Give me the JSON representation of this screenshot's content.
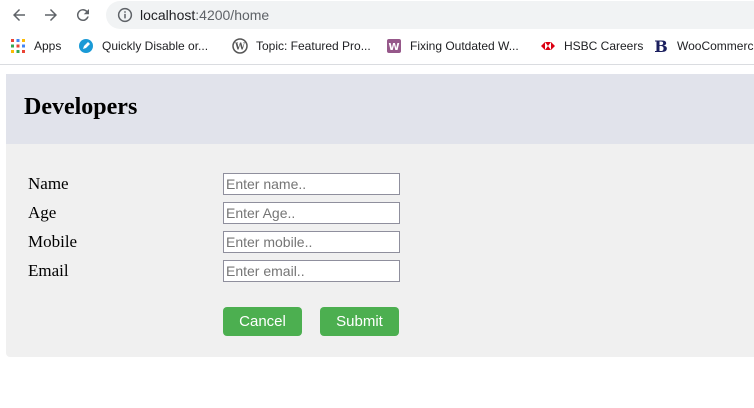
{
  "browser": {
    "url_host": "localhost",
    "url_path": ":4200/home",
    "bookmarks": [
      {
        "label": "Apps",
        "icon": "apps-grid-icon"
      },
      {
        "label": "Quickly Disable or...",
        "icon": "blue-pen-icon"
      },
      {
        "label": "Topic: Featured Pro...",
        "icon": "wordpress-icon"
      },
      {
        "label": "Fixing Outdated W...",
        "icon": "woocommerce-icon"
      },
      {
        "label": "HSBC Careers",
        "icon": "hsbc-icon"
      },
      {
        "label": "WooCommerce",
        "icon": "b-logo-icon"
      }
    ]
  },
  "page": {
    "title": "Developers",
    "form": {
      "fields": [
        {
          "label": "Name",
          "placeholder": "Enter name.."
        },
        {
          "label": "Age",
          "placeholder": "Enter Age.."
        },
        {
          "label": "Mobile",
          "placeholder": "Enter mobile.."
        },
        {
          "label": "Email",
          "placeholder": "Enter email.."
        }
      ],
      "cancel_label": "Cancel",
      "submit_label": "Submit",
      "button_color": "#4caf50"
    }
  }
}
